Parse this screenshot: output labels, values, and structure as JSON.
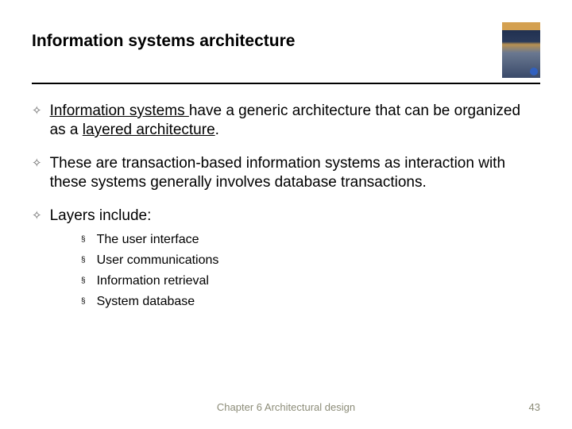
{
  "slide": {
    "title": "Information systems architecture",
    "bullets": [
      {
        "pre": "",
        "u1": "Information systems ",
        "mid": "have a generic architecture that can be organized as a ",
        "u2": "layered architecture",
        "post": "."
      },
      {
        "plain": "These are transaction-based information systems as interaction with these systems generally involves database transactions."
      },
      {
        "plain": "Layers include:"
      }
    ],
    "sublist": [
      "The user interface",
      "User communications",
      "Information retrieval",
      "System database"
    ],
    "footer_center": "Chapter 6 Architectural design",
    "footer_page": "43"
  }
}
